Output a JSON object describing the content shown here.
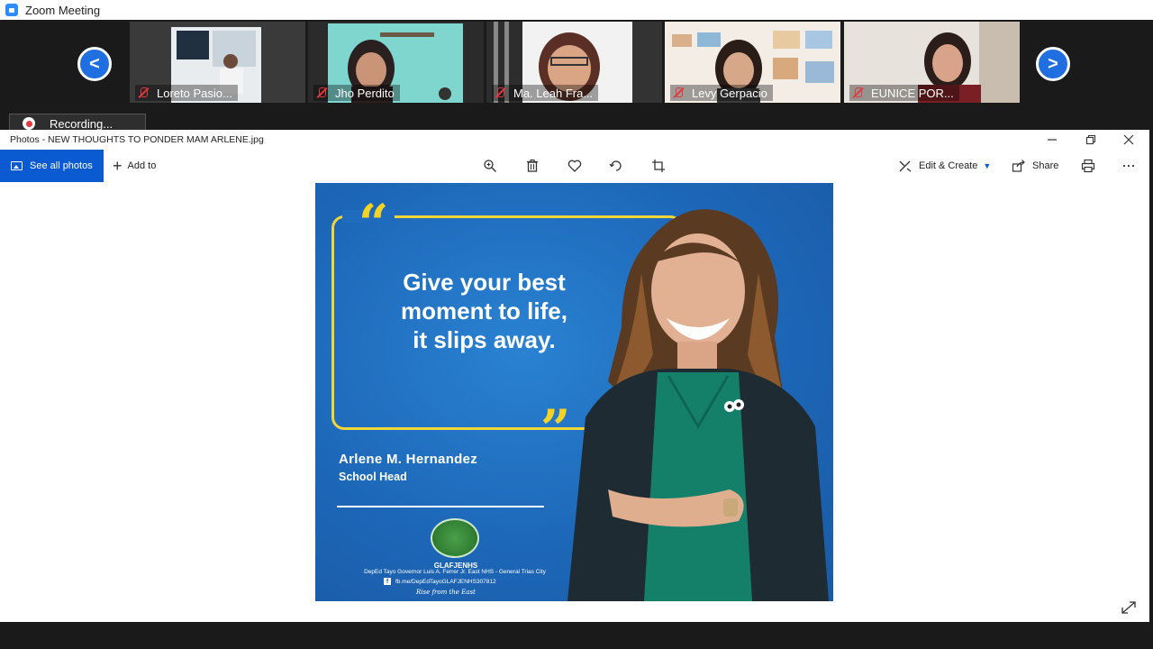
{
  "zoom": {
    "title": "Zoom Meeting",
    "recording_label": "Recording...",
    "participants": [
      {
        "name": "Loreto Pasio..."
      },
      {
        "name": "Jho Perdito"
      },
      {
        "name": "Ma. Leah Fra..."
      },
      {
        "name": "Levy Gerpacio"
      },
      {
        "name": "EUNICE POR..."
      }
    ],
    "nav_prev": "<",
    "nav_next": ">"
  },
  "photos": {
    "window_title": "Photos - NEW THOUGHTS TO PONDER MAM ARLENE.jpg",
    "toolbar": {
      "see_all_label": "See all photos",
      "add_to_label": "Add to",
      "edit_create_label": "Edit & Create",
      "share_label": "Share"
    }
  },
  "poster": {
    "open_quote": "“",
    "close_quote": "”",
    "quote_line1": "Give your best",
    "quote_line2": "moment to life,",
    "quote_line3": "it slips away.",
    "name": "Arlene M. Hernandez",
    "role": "School Head",
    "school_abbr": "GLAFJENHS",
    "school_name": "DepEd Tayo Governor Luis A. Ferrer Jr. East NHS - General Trias City",
    "fb": "fb.me/DepEdTayoGLAFJENHS307812",
    "tagline": "Rise from the East"
  },
  "colors": {
    "zoom_blue": "#1f6fe0",
    "photos_accent": "#0a5bd1",
    "poster_blue": "#1e6fc0",
    "quote_yellow": "#f5d325",
    "muted_red": "#e0393e"
  }
}
